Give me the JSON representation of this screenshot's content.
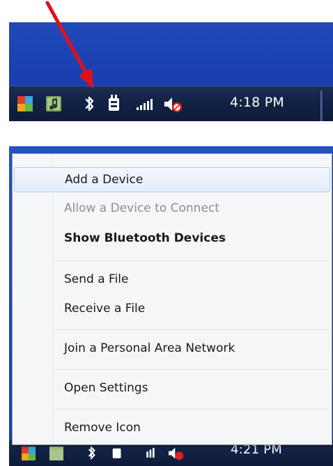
{
  "top_panel": {
    "clock": "4:18 PM",
    "tray_icons": [
      "avg-antivirus-icon",
      "music-player-icon",
      "bluetooth-icon",
      "power-plug-icon",
      "signal-bars-icon",
      "muted-speaker-icon"
    ]
  },
  "annotation": {
    "arrow_color": "#e0101a"
  },
  "bottom_panel": {
    "clock": "4:21 PM"
  },
  "context_menu": {
    "items": [
      {
        "label": "Add a Device",
        "state": "hover"
      },
      {
        "label": "Allow a Device to Connect",
        "state": "disabled"
      },
      {
        "label": "Show Bluetooth Devices",
        "state": "bold"
      },
      {
        "label": "Send a File",
        "state": "normal"
      },
      {
        "label": "Receive a File",
        "state": "normal"
      },
      {
        "label": "Join a Personal Area Network",
        "state": "normal"
      },
      {
        "label": "Open Settings",
        "state": "normal"
      },
      {
        "label": "Remove Icon",
        "state": "normal"
      }
    ]
  },
  "colors": {
    "desktop_blue": "#1d47b8",
    "taskbar": "#132347",
    "menu_bg": "#f5f6f7",
    "menu_hover_border": "#aeccf1"
  }
}
